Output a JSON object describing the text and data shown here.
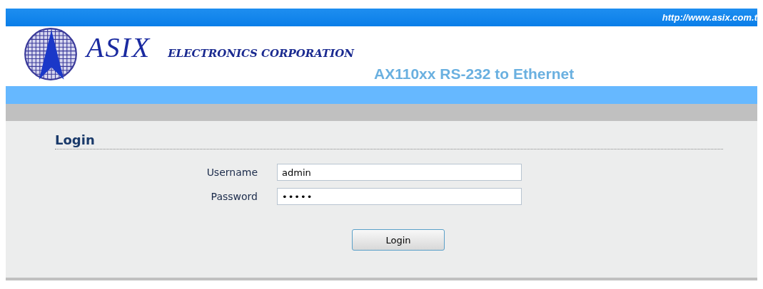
{
  "header": {
    "url": "http://www.asix.com.t",
    "brand": "ASIX",
    "company": "ELECTRONICS CORPORATION",
    "product": "AX110xx RS-232 to Ethernet"
  },
  "login": {
    "title": "Login",
    "fields": [
      {
        "label": "Username",
        "value": "admin"
      },
      {
        "label": "Password",
        "value": "•••••"
      }
    ],
    "button": "Login"
  }
}
